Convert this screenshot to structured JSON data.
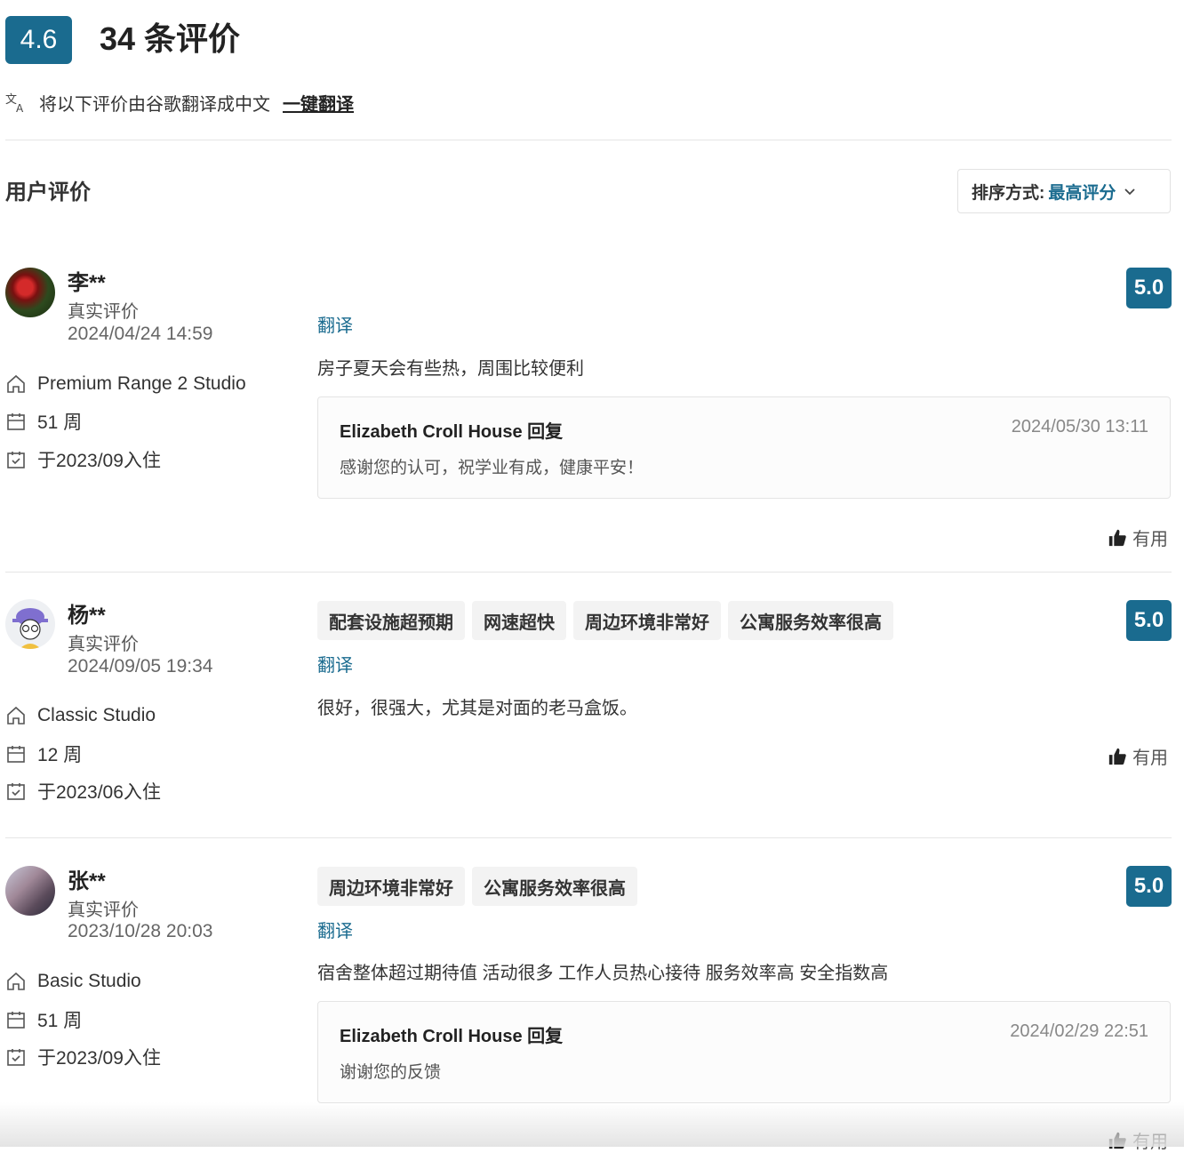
{
  "header": {
    "score": "4.6",
    "title": "34 条评价",
    "translate_prompt": "将以下评价由谷歌翻译成中文",
    "translate_all": "一键翻译"
  },
  "section": {
    "title": "用户评价",
    "sort_label": "排序方式:",
    "sort_value": "最高评分"
  },
  "reviews": [
    {
      "name": "李**",
      "verified": "真实评价",
      "date": "2024/04/24 14:59",
      "room": "Premium Range 2 Studio",
      "duration": "51 周",
      "move_in": "于2023/09入住",
      "rating": "5.0",
      "tags": [],
      "translate": "翻译",
      "text": "房子夏天会有些热，周围比较便利",
      "reply": {
        "title": "Elizabeth Croll House 回复",
        "date": "2024/05/30 13:11",
        "text": "感谢您的认可，祝学业有成，健康平安！"
      },
      "useful": "有用"
    },
    {
      "name": "杨**",
      "verified": "真实评价",
      "date": "2024/09/05 19:34",
      "room": "Classic Studio",
      "duration": "12 周",
      "move_in": "于2023/06入住",
      "rating": "5.0",
      "tags": [
        "配套设施超预期",
        "网速超快",
        "周边环境非常好",
        "公寓服务效率很高"
      ],
      "translate": "翻译",
      "text": "很好，很强大，尤其是对面的老马盒饭。",
      "useful": "有用"
    },
    {
      "name": "张**",
      "verified": "真实评价",
      "date": "2023/10/28 20:03",
      "room": "Basic Studio",
      "duration": "51 周",
      "move_in": "于2023/09入住",
      "rating": "5.0",
      "tags": [
        "周边环境非常好",
        "公寓服务效率很高"
      ],
      "translate": "翻译",
      "text": "宿舍整体超过期待值 活动很多 工作人员热心接待 服务效率高 安全指数高",
      "reply": {
        "title": "Elizabeth Croll House 回复",
        "date": "2024/02/29 22:51",
        "text": "谢谢您的反馈"
      },
      "useful": "有用"
    }
  ],
  "colors": {
    "accent": "#1a6b8f",
    "tag_bg": "#f3f3f3"
  },
  "icons": {
    "translate": "translate-icon",
    "room": "home-icon",
    "duration": "calendar-icon",
    "move_in": "calendar-check-icon",
    "useful": "thumbs-up-icon",
    "sort": "chevron-down-icon"
  }
}
